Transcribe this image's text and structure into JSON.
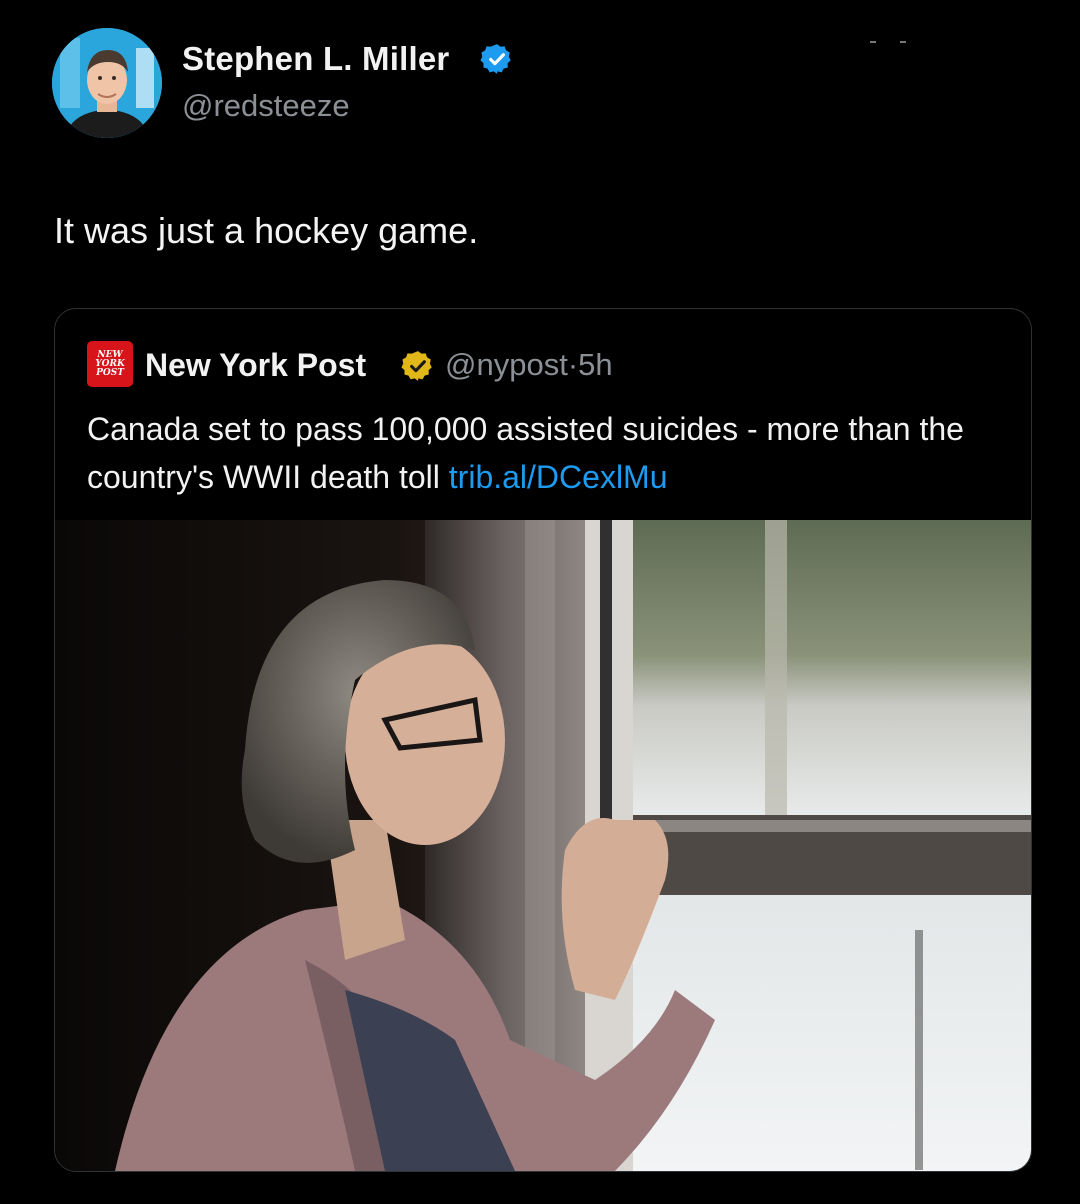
{
  "author": {
    "name": "Stephen L. Miller",
    "handle": "@redsteeze",
    "avatar_icon": "profile-photo",
    "verified_icon": "verified-badge-blue"
  },
  "tweet": {
    "text": "It was just a hockey game."
  },
  "quoted_tweet": {
    "source_logo_text": [
      "NEW",
      "YORK",
      "POST"
    ],
    "name": "New York Post",
    "verified_icon": "verified-badge-gold",
    "handle": "@nypost",
    "separator": "·",
    "time": "5h",
    "text": "Canada set to pass 100,000 assisted suicides - more than the country's WWII death toll",
    "link": "trib.al/DCexlMu",
    "image": "photo-woman-at-window"
  },
  "colors": {
    "background": "#000000",
    "link": "#1d9bf0",
    "secondary_text": "#8b9096",
    "verified_blue": "#1d9bf0",
    "verified_gold": "#e2b719",
    "nypost_red": "#d8141b"
  }
}
